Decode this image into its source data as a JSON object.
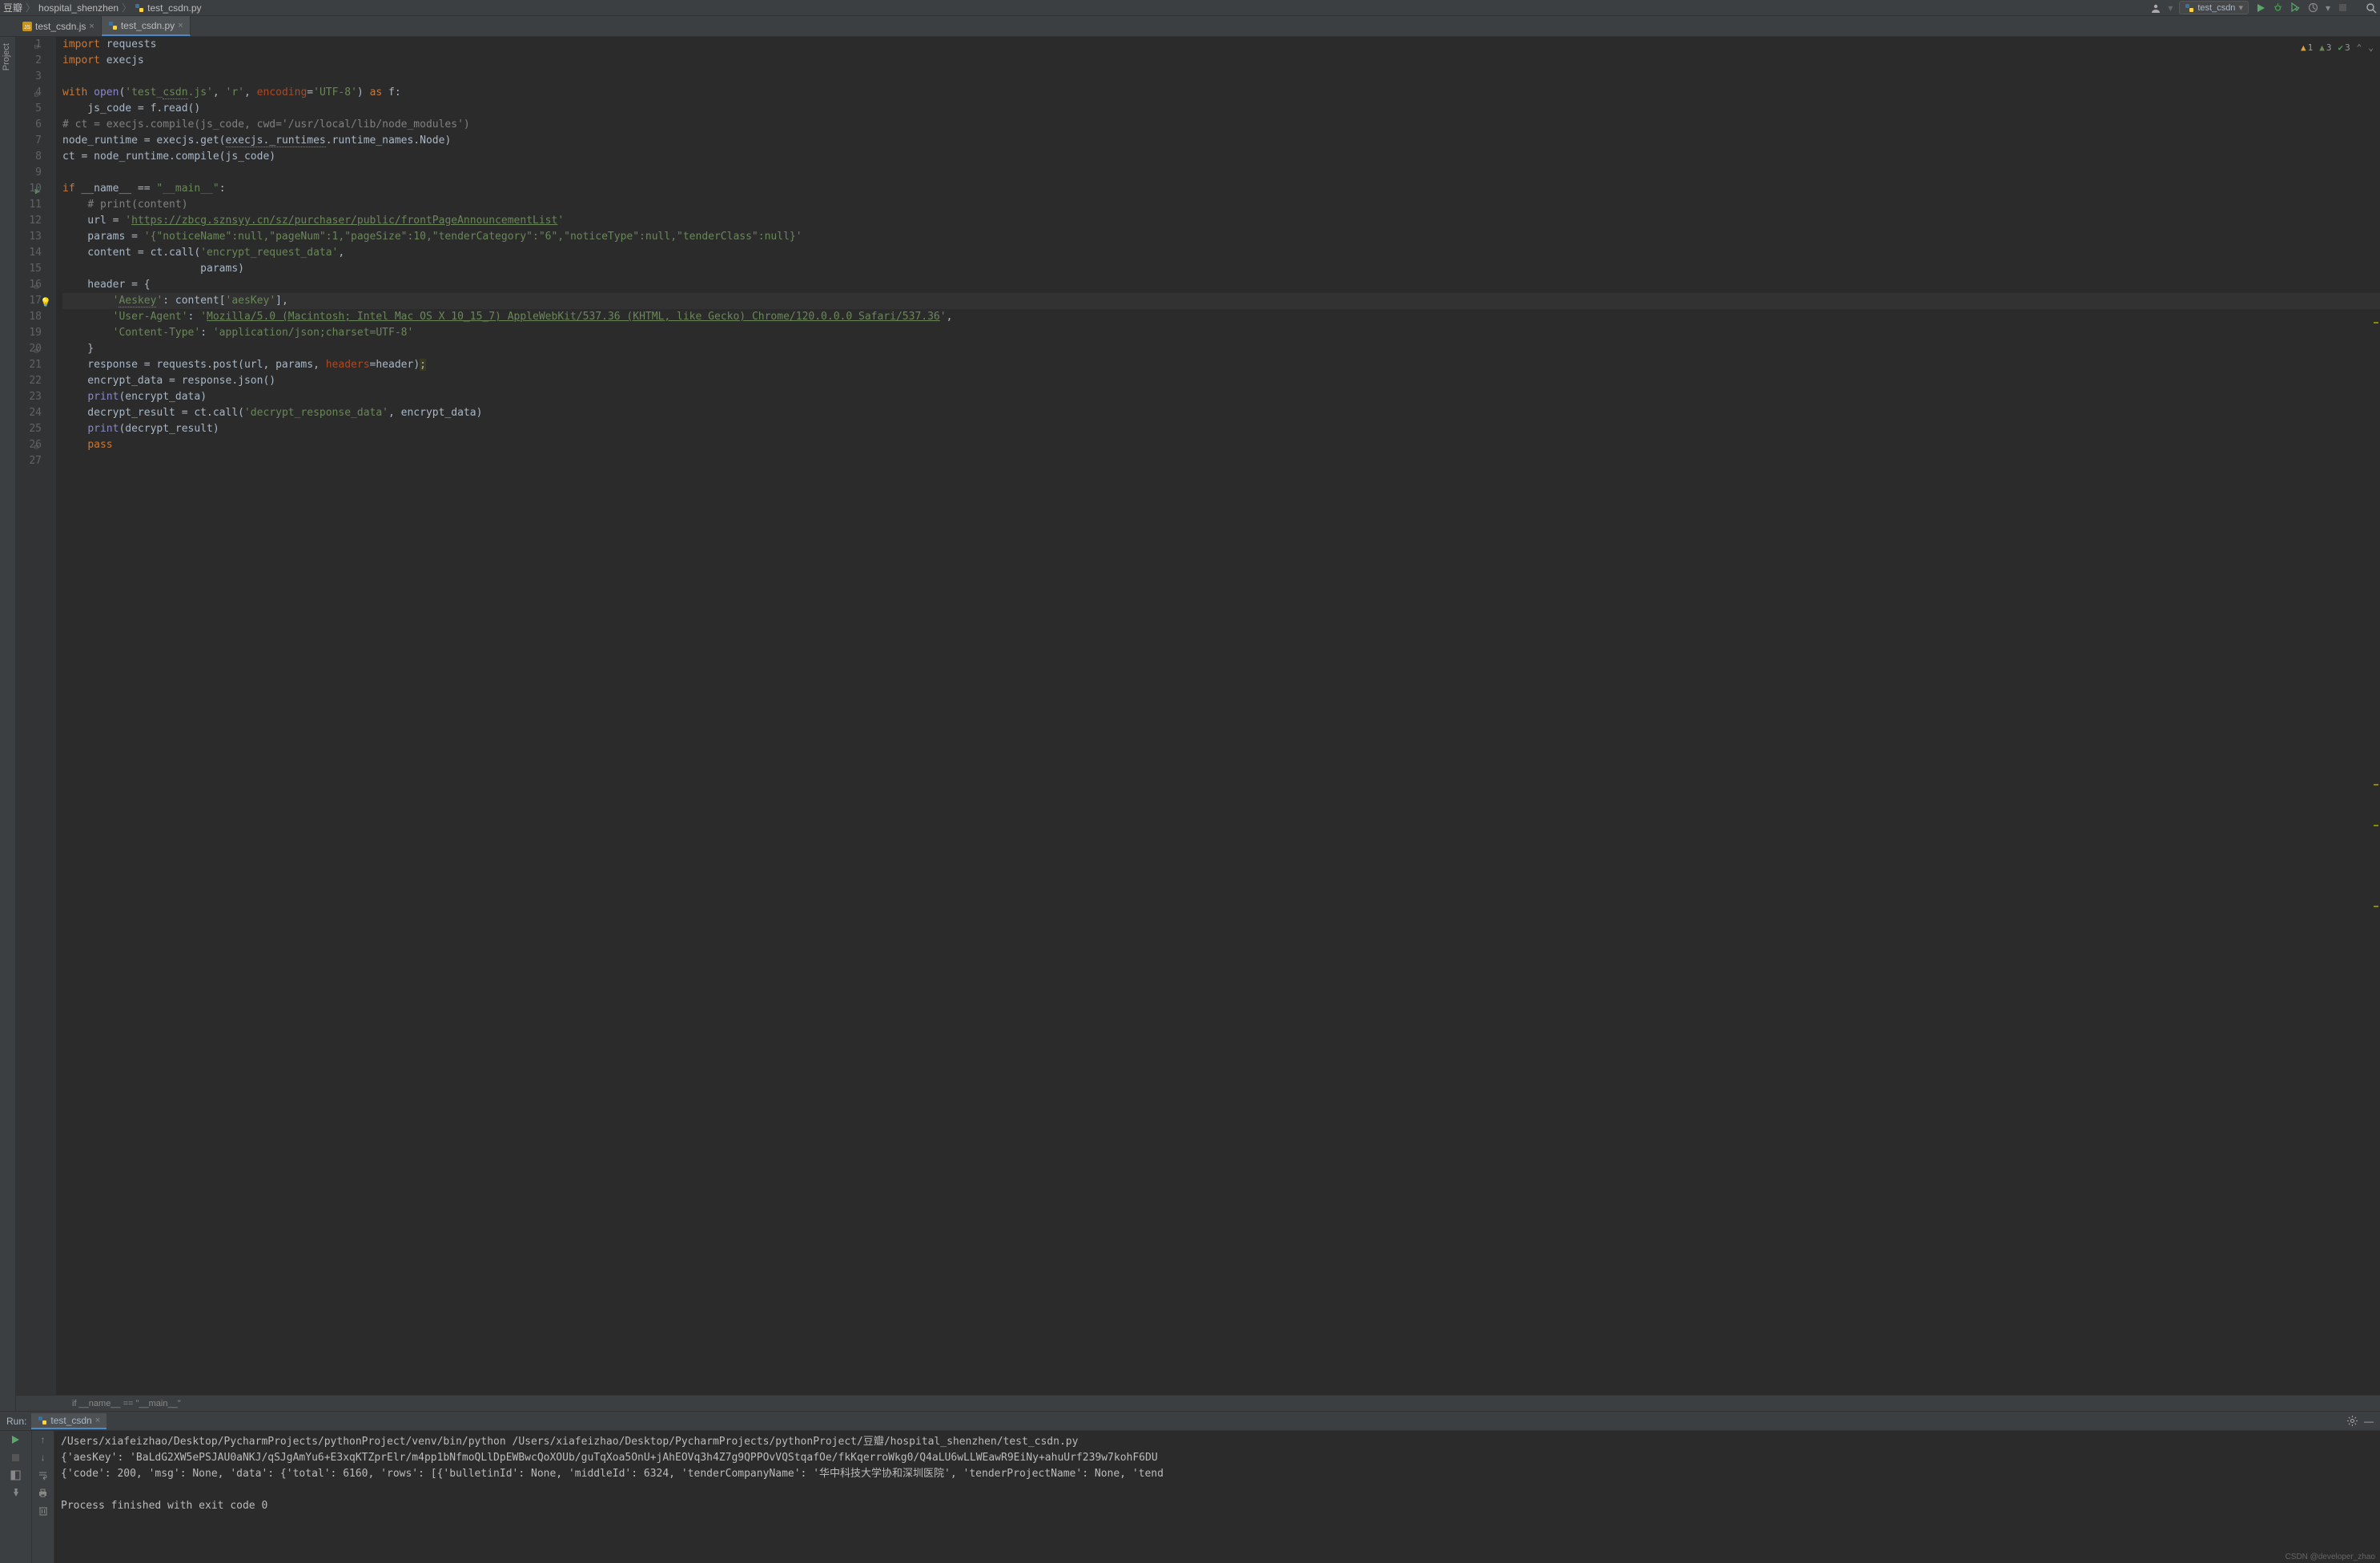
{
  "breadcrumbs": [
    "豆瓣",
    "hospital_shenzhen",
    "test_csdn.py"
  ],
  "run_config_name": "test_csdn",
  "tabs": [
    {
      "name": "test_csdn.js",
      "type": "js",
      "active": false
    },
    {
      "name": "test_csdn.py",
      "type": "py",
      "active": true
    }
  ],
  "leftrail_label": "Project",
  "inspections": {
    "warnings": 1,
    "weak_warnings": 3,
    "typos": 3
  },
  "editor_context": "if __name__ == \"__main__\"",
  "code_lines": [
    {
      "n": 1,
      "html": "<span class='kw'>import</span> requests",
      "fold": "-"
    },
    {
      "n": 2,
      "html": "<span class='kw'>import</span> execjs"
    },
    {
      "n": 3,
      "html": ""
    },
    {
      "n": 4,
      "html": "<span class='kw'>with</span> <span class='builtin'>open</span>(<span class='str'>'test_<span class='warnul'>csdn</span>.js'</span>, <span class='str'>'r'</span>, <span class='param'>encoding</span>=<span class='str'>'UTF-8'</span>) <span class='kw'>as</span> f:",
      "fold": "-"
    },
    {
      "n": 5,
      "html": "    js_code = f.read()"
    },
    {
      "n": 6,
      "html": "<span class='cmt'># ct = execjs.compile(js_code, cwd='/usr/local/lib/node_modules')</span>"
    },
    {
      "n": 7,
      "html": "node_runtime = execjs.get(<span class='warnul'>execjs._runtimes</span>.runtime_names.Node)"
    },
    {
      "n": 8,
      "html": "ct = node_runtime.compile(js_code)"
    },
    {
      "n": 9,
      "html": ""
    },
    {
      "n": 10,
      "html": "<span class='kw'>if</span> __name__ == <span class='str'>\"__main__\"</span>:",
      "run": true,
      "fold": "-"
    },
    {
      "n": 11,
      "html": "    <span class='cmt'># print(content)</span>"
    },
    {
      "n": 12,
      "html": "    url = <span class='str'>'</span><span class='url'>https://zbcg.sznsyy.cn/sz/purchaser/public/frontPageAnnouncementList</span><span class='str'>'</span>"
    },
    {
      "n": 13,
      "html": "    params = <span class='str'>'{\"noticeName\":null,\"pageNum\":1,\"pageSize\":10,\"tenderCategory\":\"6\",\"noticeType\":null,\"tenderClass\":null}'</span>"
    },
    {
      "n": 14,
      "html": "    content = ct.call(<span class='str'>'encrypt_request_data'</span>,"
    },
    {
      "n": 15,
      "html": "                      params)"
    },
    {
      "n": 16,
      "html": "    header = {",
      "fold": "-"
    },
    {
      "n": 17,
      "html": "        <span class='str'>'<span class='warnul'>Aeskey</span>'</span>: content[<span class='str'>'aesKey'</span>],",
      "hl": true,
      "bulb": true
    },
    {
      "n": 18,
      "html": "        <span class='str'>'User-Agent'</span>: <span class='str'>'</span><span class='url'>Mozilla/5.0 (Macintosh; Intel Mac OS X 10_15_7) AppleWebKit/537.36 (KHTML, like Gecko) Chrome/120.0.0.0 Safari/537.36</span><span class='str'>'</span>,"
    },
    {
      "n": 19,
      "html": "        <span class='str'>'Content-Type'</span>: <span class='str'>'application/json;charset=UTF-8'</span>"
    },
    {
      "n": 20,
      "html": "    }",
      "fold": "e"
    },
    {
      "n": 21,
      "html": "    response = requests.post(url, params, <span class='param'>headers</span>=header)<span class='semi-warn'>;</span>"
    },
    {
      "n": 22,
      "html": "    encrypt_data = response.json()"
    },
    {
      "n": 23,
      "html": "    <span class='builtin'>print</span>(encrypt_data)"
    },
    {
      "n": 24,
      "html": "    decrypt_result = ct.call(<span class='str'>'decrypt_response_data'</span>, encrypt_data)"
    },
    {
      "n": 25,
      "html": "    <span class='builtin'>print</span>(decrypt_result)"
    },
    {
      "n": 26,
      "html": "    <span class='kw'>pass</span>",
      "fold": "e"
    },
    {
      "n": 27,
      "html": ""
    }
  ],
  "run_panel": {
    "title": "Run:",
    "tab": "test_csdn",
    "output": [
      "/Users/xiafeizhao/Desktop/PycharmProjects/pythonProject/venv/bin/python /Users/xiafeizhao/Desktop/PycharmProjects/pythonProject/豆瓣/hospital_shenzhen/test_csdn.py",
      "{'aesKey': 'BaLdG2XW5ePSJAU0aNKJ/qSJgAmYu6+E3xqKTZprElr/m4pp1bNfmoQLlDpEWBwcQoXOUb/guTqXoa5OnU+jAhEOVq3h4Z7g9QPPOvVQStqafOe/fkKqerroWkg0/Q4aLU6wLLWEawR9EiNy+ahuUrf239w7kohF6DU",
      "{'code': 200, 'msg': None, 'data': {'total': 6160, 'rows': [{'bulletinId': None, 'middleId': 6324, 'tenderCompanyName': '华中科技大学协和深圳医院', 'tenderProjectName': None, 'tend",
      "",
      "Process finished with exit code 0"
    ]
  },
  "watermark": "CSDN @developer_zhao"
}
